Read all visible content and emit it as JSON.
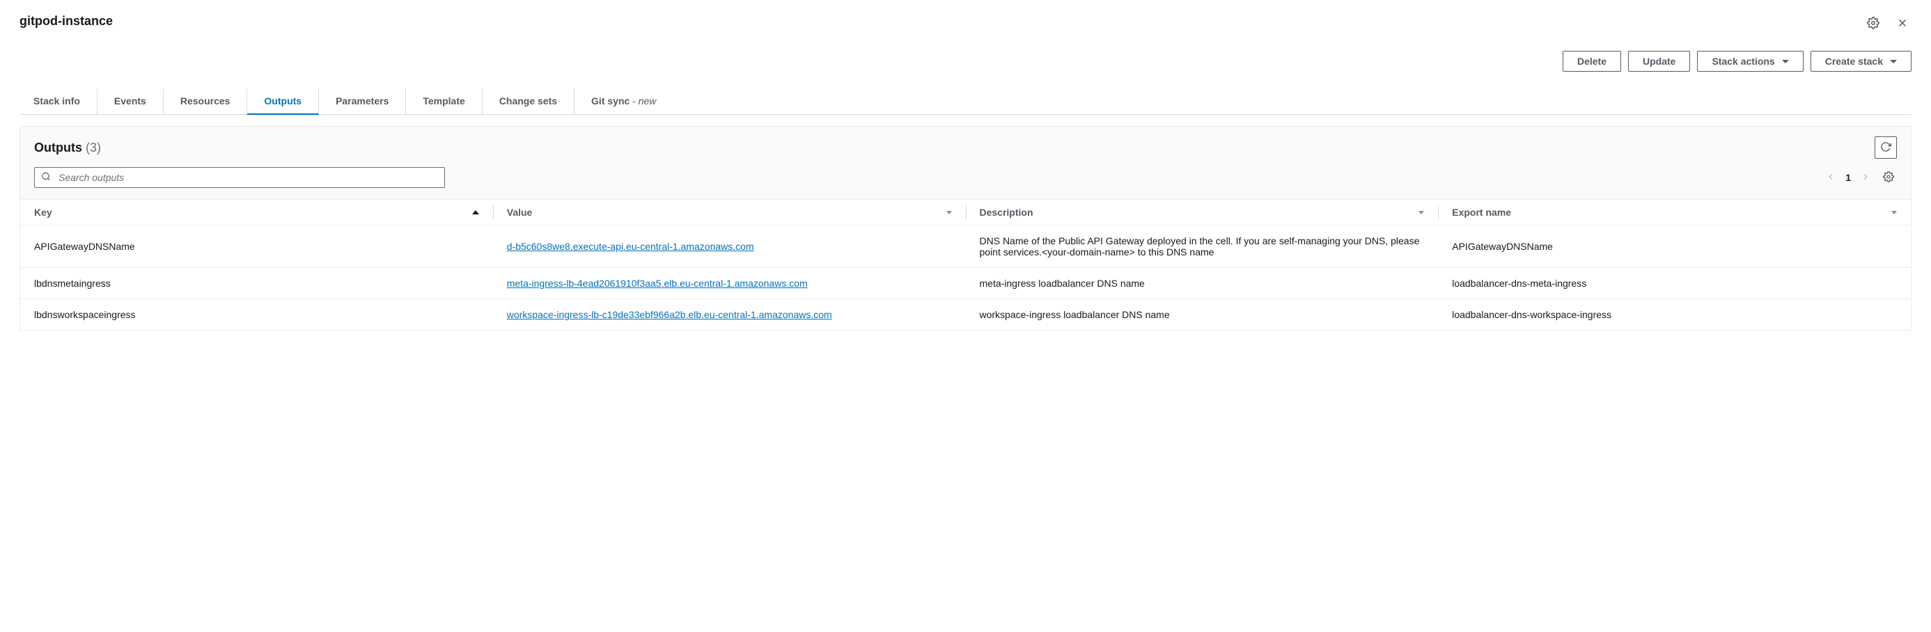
{
  "header": {
    "title": "gitpod-instance"
  },
  "actions": {
    "delete": "Delete",
    "update": "Update",
    "stack_actions": "Stack actions",
    "create_stack": "Create stack"
  },
  "tabs": [
    {
      "label": "Stack info",
      "active": false
    },
    {
      "label": "Events",
      "active": false
    },
    {
      "label": "Resources",
      "active": false
    },
    {
      "label": "Outputs",
      "active": true
    },
    {
      "label": "Parameters",
      "active": false
    },
    {
      "label": "Template",
      "active": false
    },
    {
      "label": "Change sets",
      "active": false
    },
    {
      "label": "Git sync",
      "suffix": " - new",
      "active": false
    }
  ],
  "panel": {
    "title": "Outputs",
    "count": "(3)",
    "search_placeholder": "Search outputs",
    "page": "1"
  },
  "columns": {
    "key": "Key",
    "value": "Value",
    "description": "Description",
    "export_name": "Export name"
  },
  "rows": [
    {
      "key": "APIGatewayDNSName",
      "value": "d-b5c60s8we8.execute-api.eu-central-1.amazonaws.com",
      "description": "DNS Name of the Public API Gateway deployed in the cell. If you are self-managing your DNS, please point services.<your-domain-name> to this DNS name",
      "export_name": "APIGatewayDNSName"
    },
    {
      "key": "lbdnsmetaingress",
      "value": "meta-ingress-lb-4ead2061910f3aa5.elb.eu-central-1.amazonaws.com",
      "description": "meta-ingress loadbalancer DNS name",
      "export_name": "loadbalancer-dns-meta-ingress"
    },
    {
      "key": "lbdnsworkspaceingress",
      "value": "workspace-ingress-lb-c19de33ebf966a2b.elb.eu-central-1.amazonaws.com",
      "description": "workspace-ingress loadbalancer DNS name",
      "export_name": "loadbalancer-dns-workspace-ingress"
    }
  ]
}
